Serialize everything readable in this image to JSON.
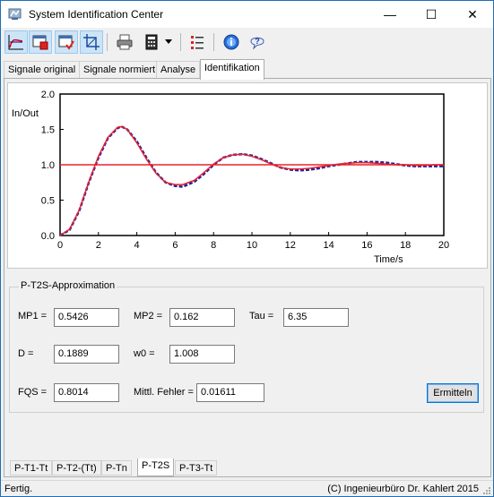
{
  "window": {
    "title": "System Identification Center",
    "minimize_glyph": "—",
    "maximize_glyph": "☐",
    "close_glyph": "✕"
  },
  "toolbar": {
    "icons": [
      "step-response-icon",
      "window-red-icon",
      "window-check-icon",
      "crop-icon",
      "printer-icon",
      "calculator-icon",
      "dropdown-arrow-icon",
      "list-icon",
      "info-icon",
      "help-icon"
    ]
  },
  "tabs": [
    "Signale original",
    "Signale normiert",
    "Analyse",
    "Identifikation"
  ],
  "active_tab": "Identifikation",
  "chart_data": {
    "type": "line",
    "ylabel": "In/Out",
    "xlabel": "Time/s",
    "xlim": [
      0,
      20
    ],
    "ylim": [
      0,
      2
    ],
    "xticks": [
      "0",
      "2",
      "4",
      "6",
      "8",
      "10",
      "12",
      "14",
      "16",
      "18",
      "20"
    ],
    "yticks": [
      "0.0",
      "0.5",
      "1.0",
      "1.5",
      "2.0"
    ],
    "grid": false,
    "series": [
      {
        "color": "#1f1fa0",
        "style": "dashed",
        "x": [
          0,
          0.5,
          1,
          1.5,
          2,
          2.5,
          3,
          3.2,
          3.5,
          4,
          4.5,
          5,
          5.5,
          6,
          6.4,
          7,
          7.5,
          8,
          8.5,
          9,
          9.5,
          10,
          10.5,
          11,
          11.5,
          12,
          12.5,
          13,
          13.5,
          14,
          14.5,
          15,
          15.5,
          16,
          16.5,
          17,
          17.5,
          18,
          18.5,
          19,
          19.5,
          20
        ],
        "y": [
          0,
          0.08,
          0.35,
          0.75,
          1.1,
          1.38,
          1.52,
          1.54,
          1.5,
          1.33,
          1.1,
          0.89,
          0.75,
          0.7,
          0.69,
          0.76,
          0.87,
          1.0,
          1.1,
          1.14,
          1.15,
          1.13,
          1.08,
          1.02,
          0.96,
          0.93,
          0.92,
          0.93,
          0.95,
          0.98,
          1.0,
          1.02,
          1.04,
          1.04,
          1.04,
          1.03,
          1.01,
          0.99,
          0.98,
          0.98,
          0.98,
          0.98
        ]
      },
      {
        "color": "#e8232a",
        "style": "solid",
        "x": [
          0,
          0.5,
          1,
          1.5,
          2,
          2.5,
          3,
          3.2,
          3.5,
          4,
          4.5,
          5,
          5.5,
          6,
          6.4,
          7,
          7.5,
          8,
          8.5,
          9,
          9.5,
          10,
          10.5,
          11,
          11.5,
          12,
          12.5,
          13,
          13.5,
          14,
          14.5,
          15,
          15.5,
          16,
          16.5,
          17,
          17.5,
          18,
          18.5,
          19,
          19.5,
          20
        ],
        "y": [
          0,
          0.09,
          0.36,
          0.76,
          1.12,
          1.39,
          1.53,
          1.54,
          1.5,
          1.31,
          1.08,
          0.88,
          0.75,
          0.72,
          0.72,
          0.78,
          0.89,
          1.01,
          1.1,
          1.14,
          1.15,
          1.12,
          1.07,
          1.01,
          0.96,
          0.94,
          0.94,
          0.95,
          0.97,
          0.99,
          1.01,
          1.02,
          1.03,
          1.03,
          1.02,
          1.01,
          1.0,
          1.0,
          0.99,
          0.99,
          1.0,
          1.0
        ]
      },
      {
        "color": "#e8232a",
        "style": "solid",
        "x": [
          0,
          20
        ],
        "y": [
          1.0,
          1.0
        ]
      }
    ]
  },
  "approximation": {
    "title": "P-T2S-Approximation",
    "mp1_label": "MP1  =",
    "mp1_value": "0.5426",
    "mp2_label": "MP2  =",
    "mp2_value": "0.162",
    "tau_label": "Tau  =",
    "tau_value": "6.35",
    "d_label": "D   =",
    "d_value": "0.1889",
    "w0_label": "w0  =",
    "w0_value": "1.008",
    "fqs_label": "FQS  =",
    "fqs_value": "0.8014",
    "fehler_label": "Mittl. Fehler  =",
    "fehler_value": "0.01611",
    "ermitteln_label": "Ermitteln"
  },
  "subtabs": [
    "P-T1-Tt",
    "P-T2-(Tt)",
    "P-Tn",
    "P-T2S",
    "P-T3-Tt"
  ],
  "active_subtab": "P-T2S",
  "status": {
    "left": "Fertig.",
    "right": "(C) Ingenieurbüro Dr. Kahlert 2015"
  }
}
